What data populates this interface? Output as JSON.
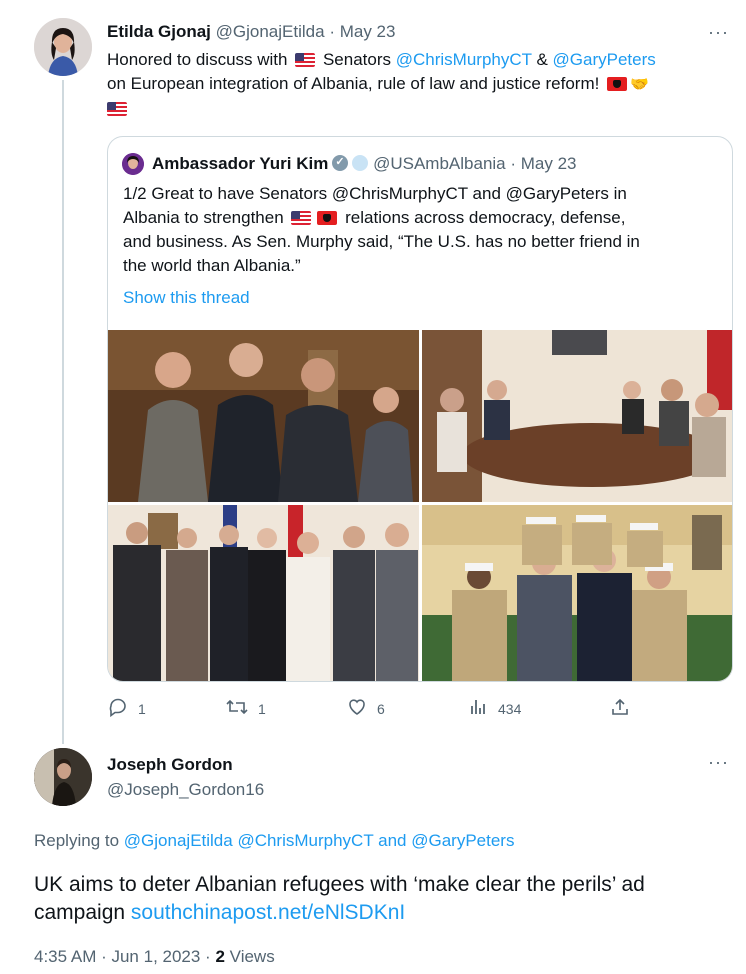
{
  "tweet": {
    "author_name": "Etilda Gjonaj",
    "author_handle": "@GjonajEtilda",
    "date": "· May 23",
    "more": "···",
    "text_part1": "Honored to discuss with",
    "text_part2": "Senators",
    "mention1": "@ChrisMurphyCT",
    "amp": "&",
    "mention2": "@GaryPeters",
    "text_part3": "on European integration of Albania, rule of law and justice reform!",
    "emoji_handshake": "🤝",
    "flag_us": "us-flag-icon",
    "flag_al": "albania-flag-icon"
  },
  "quote": {
    "author_name": "Ambassador Yuri Kim",
    "author_handle": "@USAmbAlbania",
    "date": "· May 23",
    "line1": "1/2 Great to have Senators @ChrisMurphyCT and @GaryPeters in",
    "line2a": "Albania to strengthen",
    "line2b": "relations across democracy, defense,",
    "line3": "and business. As Sen. Murphy said, “The U.S. has no better friend in",
    "line4": "the world than Albania.”",
    "show_thread": "Show this thread",
    "photos": [
      "photo-senators-conversation",
      "photo-meeting-table",
      "photo-group-portrait",
      "photo-marines-group"
    ]
  },
  "actions": {
    "replies": "1",
    "retweets": "1",
    "likes": "6",
    "views": "434"
  },
  "reply": {
    "author_name": "Joseph Gordon",
    "author_handle": "@Joseph_Gordon16",
    "more": "···",
    "replying_prefix": "Replying to",
    "replying_to": "@GjonajEtilda @ChrisMurphyCT and @GaryPeters",
    "text_line1": "UK aims to deter Albanian refugees with ‘make clear the perils’ ad",
    "text_line2": "campaign",
    "link": "southchinapost.net/eNlSDKnI",
    "timestamp": "4:35 AM · Jun 1, 2023 ·",
    "views_count": "2",
    "views_label": "Views"
  },
  "colors": {
    "link": "#1d9bf0",
    "muted": "#536471",
    "border": "#cfd9de"
  }
}
